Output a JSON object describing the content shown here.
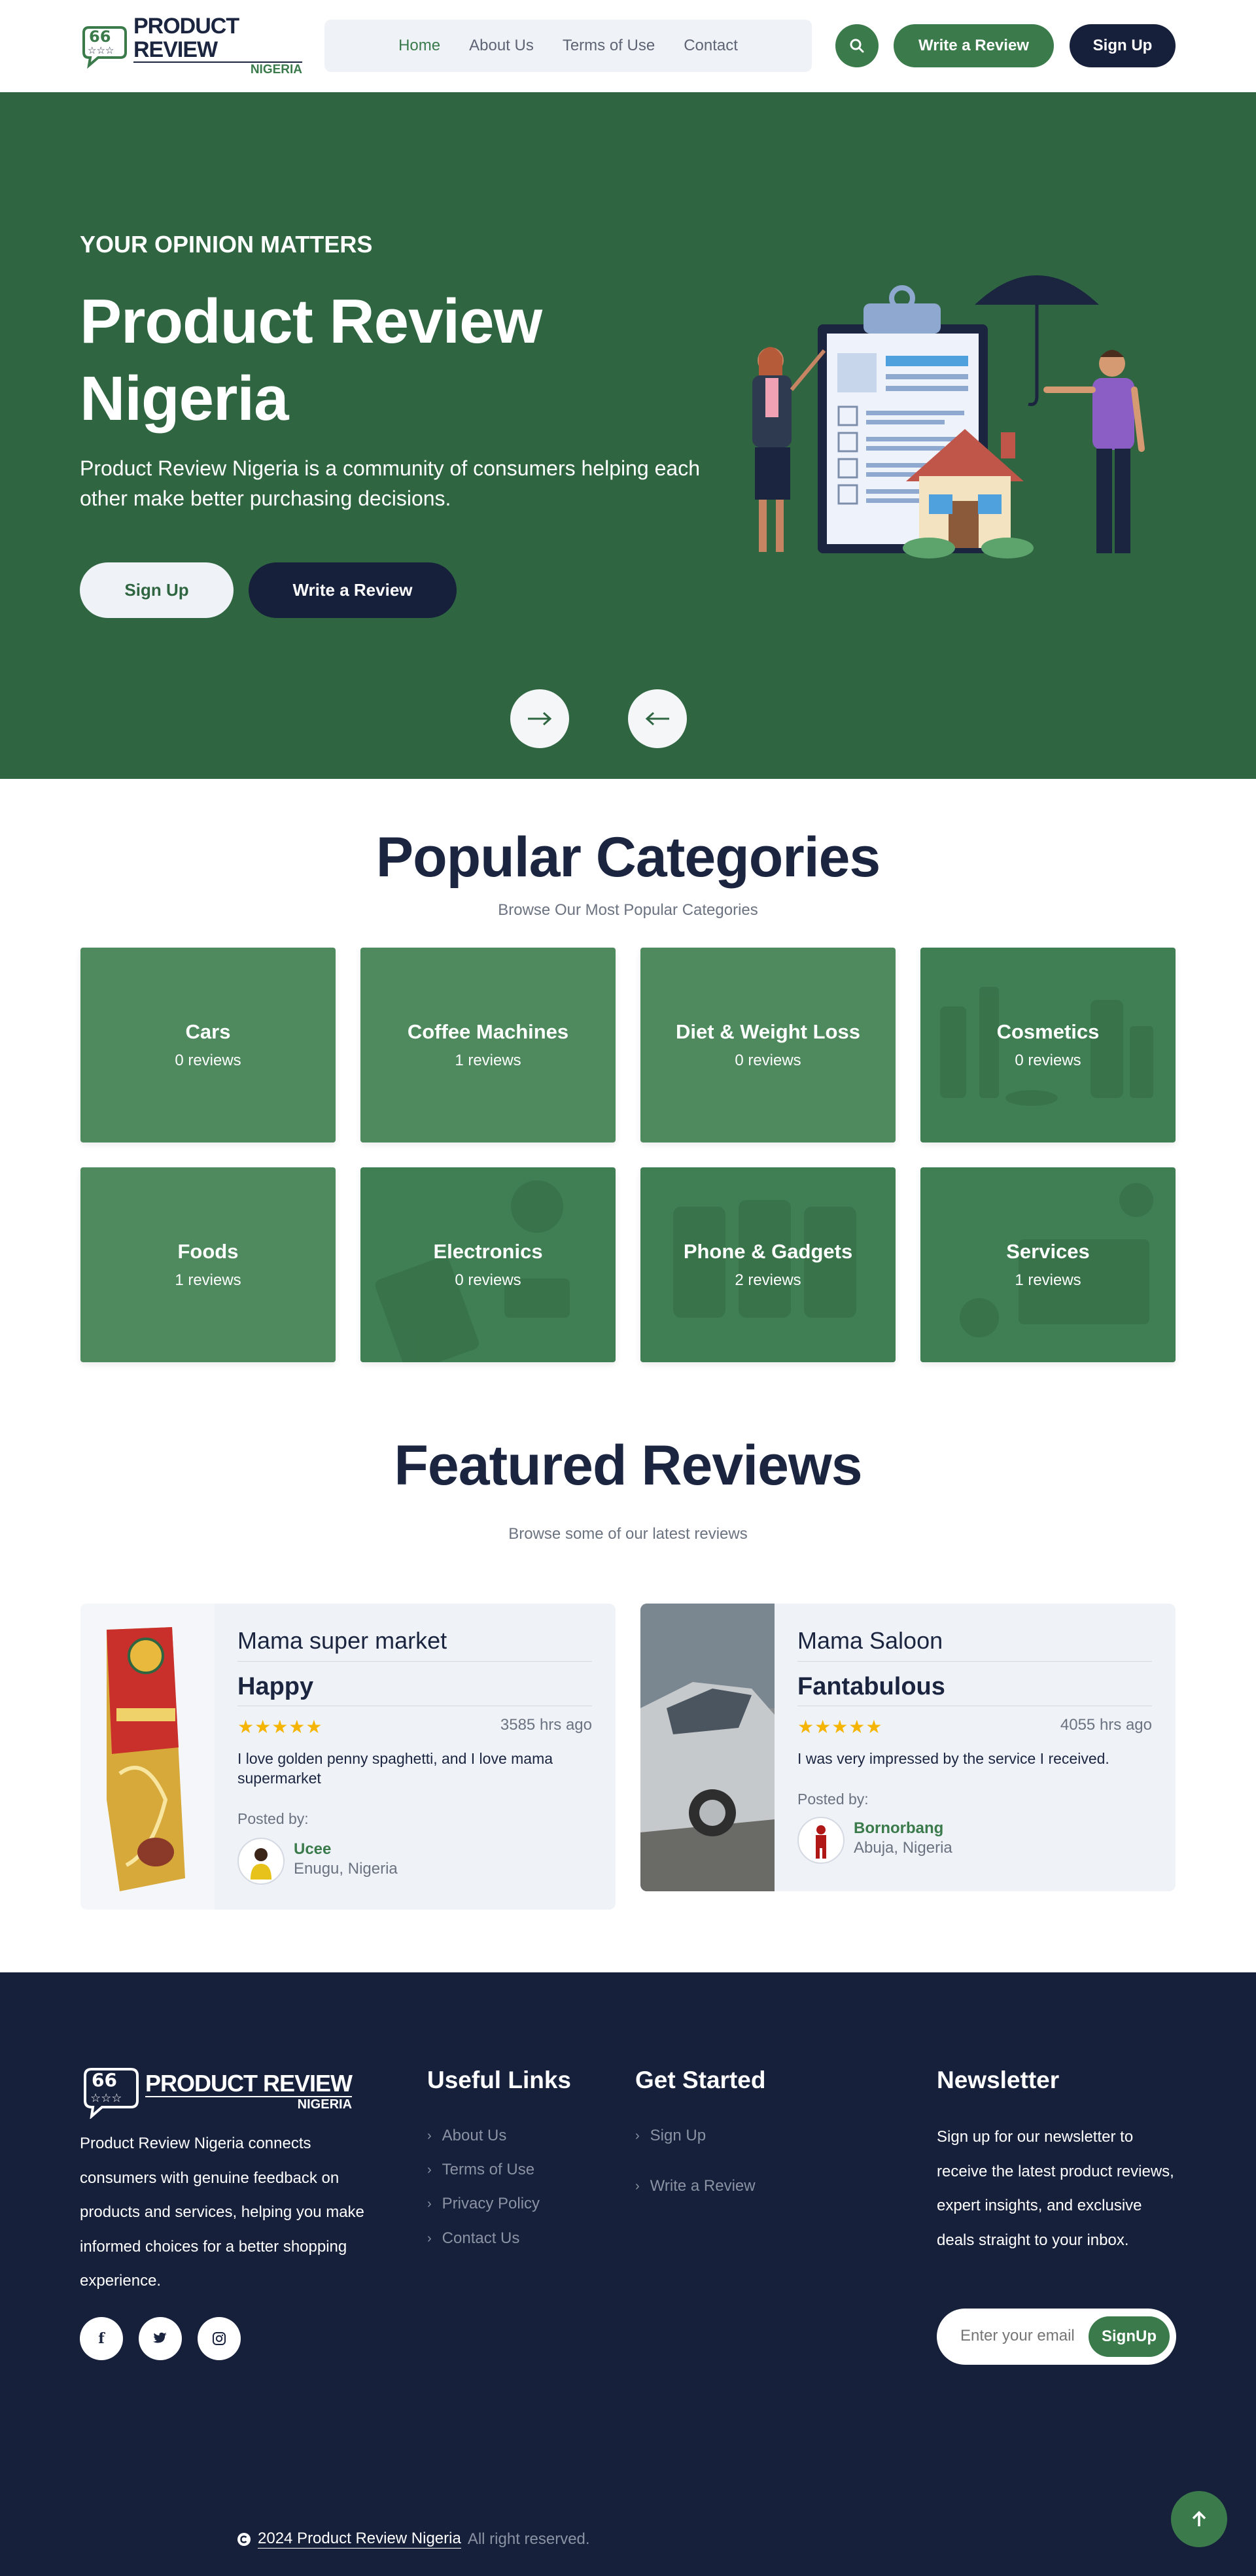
{
  "brand": {
    "logo_text_main": "PRODUCT REVIEW",
    "logo_text_sub": "NIGERIA",
    "accent_color": "#3a7a4b",
    "dark_color": "#16203b"
  },
  "nav": {
    "items": [
      {
        "label": "Home",
        "active": true
      },
      {
        "label": "About Us",
        "active": false
      },
      {
        "label": "Terms of Use",
        "active": false
      },
      {
        "label": "Contact",
        "active": false
      }
    ],
    "search_icon": "search-icon",
    "write_review_label": "Write a Review",
    "signup_label": "Sign Up"
  },
  "hero": {
    "kicker": "YOUR OPINION MATTERS",
    "title": "Product Review Nigeria",
    "description": "Product Review Nigeria is a community of consumers helping each other make better purchasing decisions.",
    "signup_label": "Sign Up",
    "write_review_label": "Write a Review",
    "next_icon": "arrow-right-icon",
    "prev_icon": "arrow-left-icon"
  },
  "categories": {
    "title": "Popular Categories",
    "subtitle": "Browse Our Most Popular Categories",
    "items": [
      {
        "name": "Cars",
        "count": "0 reviews"
      },
      {
        "name": "Coffee Machines",
        "count": "1 reviews"
      },
      {
        "name": "Diet & Weight Loss",
        "count": "0 reviews"
      },
      {
        "name": "Cosmetics",
        "count": "0 reviews"
      },
      {
        "name": "Foods",
        "count": "1 reviews"
      },
      {
        "name": "Electronics",
        "count": "0 reviews"
      },
      {
        "name": "Phone & Gadgets",
        "count": "2 reviews"
      },
      {
        "name": "Services",
        "count": "1 reviews"
      }
    ]
  },
  "reviews": {
    "title": "Featured Reviews",
    "subtitle": "Browse some of our latest reviews",
    "items": [
      {
        "store": "Mama super market",
        "title": "Happy",
        "stars": "★★★★★",
        "rating": 5,
        "time": "3585 hrs ago",
        "text": "I love golden penny spaghetti, and I love mama supermarket",
        "posted_by": "Posted by:",
        "user": "Ucee",
        "location": "Enugu, Nigeria"
      },
      {
        "store": "Mama Saloon",
        "title": "Fantabulous",
        "stars": "★★★★★",
        "rating": 5,
        "time": "4055 hrs ago",
        "text": "I was very impressed by the service I received.",
        "posted_by": "Posted by:",
        "user": "Bornorbang",
        "location": "Abuja, Nigeria"
      }
    ]
  },
  "footer": {
    "description": "Product Review Nigeria connects consumers with genuine feedback on products and services, helping you make informed choices for a better shopping experience.",
    "social_icons": [
      "facebook-icon",
      "twitter-icon",
      "instagram-icon"
    ],
    "useful_links": {
      "title": "Useful Links",
      "items": [
        "About Us",
        "Terms of Use",
        "Privacy Policy",
        "Contact Us"
      ]
    },
    "get_started": {
      "title": "Get Started",
      "items": [
        "Sign Up",
        "Write a Review"
      ]
    },
    "newsletter": {
      "title": "Newsletter",
      "text": "Sign up for our newsletter to receive the latest product reviews, expert insights, and exclusive deals straight to your inbox.",
      "placeholder": "Enter your email",
      "button": "SignUp"
    },
    "copyright_link": "2024 Product Review Nigeria",
    "copyright_rest": "All right reserved."
  }
}
